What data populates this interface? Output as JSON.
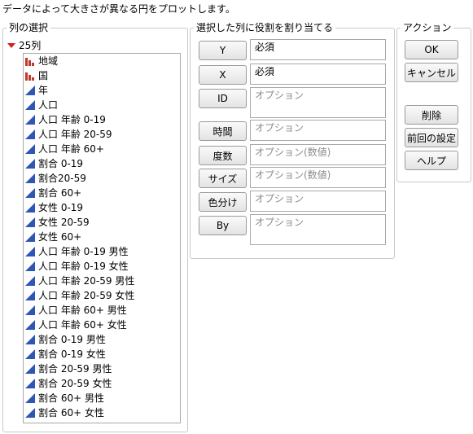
{
  "description": "データによって大きさが異なる円をプロットします。",
  "columns_panel": {
    "title": "列の選択",
    "count_label": "25列",
    "items": [
      {
        "label": "地域",
        "icon": "nominal-bar-icon"
      },
      {
        "label": "国",
        "icon": "nominal-bar-icon"
      },
      {
        "label": "年",
        "icon": "continuous-triangle-icon"
      },
      {
        "label": "人口",
        "icon": "continuous-triangle-icon"
      },
      {
        "label": "人口 年齢 0-19",
        "icon": "continuous-triangle-icon"
      },
      {
        "label": "人口 年齢 20-59",
        "icon": "continuous-triangle-icon"
      },
      {
        "label": "人口 年齢 60+",
        "icon": "continuous-triangle-icon"
      },
      {
        "label": "割合 0-19",
        "icon": "continuous-triangle-icon"
      },
      {
        "label": "割合20-59",
        "icon": "continuous-triangle-icon"
      },
      {
        "label": "割合 60+",
        "icon": "continuous-triangle-icon"
      },
      {
        "label": "女性 0-19",
        "icon": "continuous-triangle-icon"
      },
      {
        "label": "女性 20-59",
        "icon": "continuous-triangle-icon"
      },
      {
        "label": "女性 60+",
        "icon": "continuous-triangle-icon"
      },
      {
        "label": "人口 年齢 0-19 男性",
        "icon": "continuous-triangle-icon"
      },
      {
        "label": "人口 年齢 0-19 女性",
        "icon": "continuous-triangle-icon"
      },
      {
        "label": "人口 年齢 20-59 男性",
        "icon": "continuous-triangle-icon"
      },
      {
        "label": "人口 年齢 20-59 女性",
        "icon": "continuous-triangle-icon"
      },
      {
        "label": "人口 年齢 60+ 男性",
        "icon": "continuous-triangle-icon"
      },
      {
        "label": "人口 年齢 60+ 女性",
        "icon": "continuous-triangle-icon"
      },
      {
        "label": "割合 0-19 男性",
        "icon": "continuous-triangle-icon"
      },
      {
        "label": "割合 0-19 女性",
        "icon": "continuous-triangle-icon"
      },
      {
        "label": "割合 20-59 男性",
        "icon": "continuous-triangle-icon"
      },
      {
        "label": "割合 20-59 女性",
        "icon": "continuous-triangle-icon"
      },
      {
        "label": "割合 60+ 男性",
        "icon": "continuous-triangle-icon"
      },
      {
        "label": "割合 60+ 女性",
        "icon": "continuous-triangle-icon"
      }
    ]
  },
  "roles_panel": {
    "title": "選択した列に役割を割り当てる",
    "roles": [
      {
        "button": "Y",
        "value": "必須",
        "required": true
      },
      {
        "button": "X",
        "value": "必須",
        "required": true
      },
      {
        "button": "ID",
        "value": "オプション",
        "required": false
      },
      {
        "button": "時間",
        "value": "オプション",
        "required": false
      },
      {
        "button": "度数",
        "value": "オプション(数値)",
        "required": false
      },
      {
        "button": "サイズ",
        "value": "オプション(数値)",
        "required": false
      },
      {
        "button": "色分け",
        "value": "オプション",
        "required": false
      },
      {
        "button": "By",
        "value": "オプション",
        "required": false
      }
    ]
  },
  "actions_panel": {
    "title": "アクション",
    "ok": "OK",
    "cancel": "キャンセル",
    "remove": "削除",
    "recall": "前回の設定",
    "help": "ヘルプ"
  },
  "colors": {
    "nominal_icon": "#c0392b",
    "continuous_icon": "#2f55b5",
    "disclosure": "#d21f1f"
  }
}
